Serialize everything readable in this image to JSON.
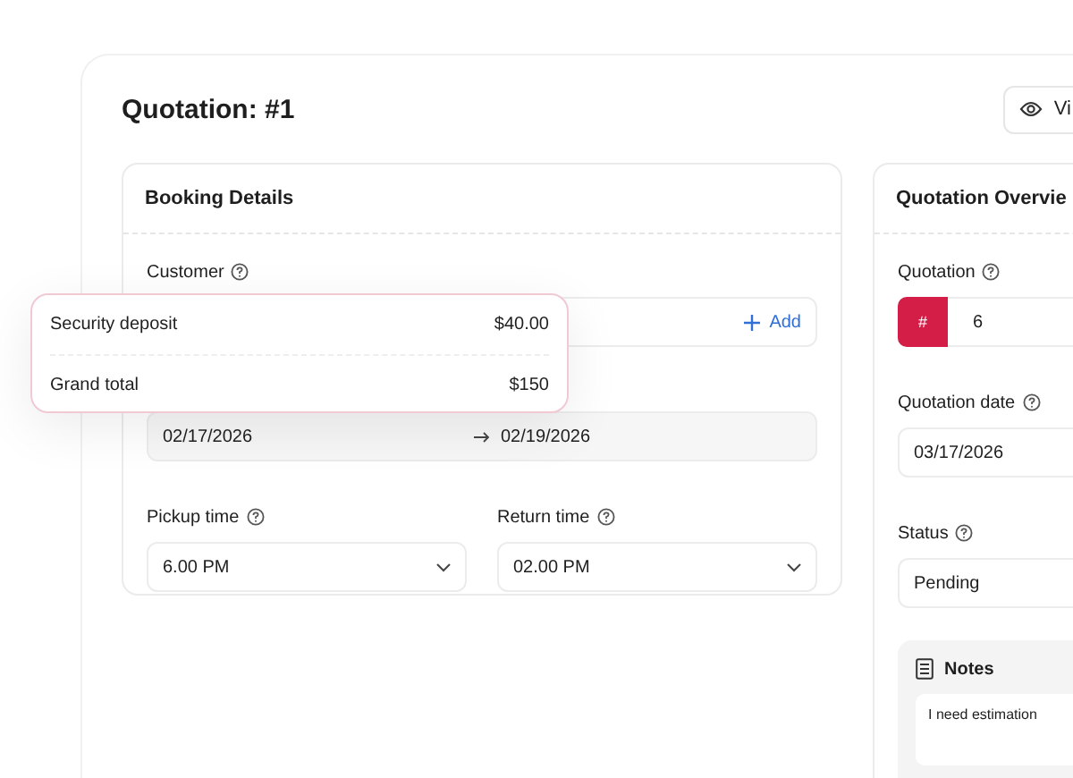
{
  "page": {
    "title": "Quotation: #1",
    "view_button": "Vi"
  },
  "booking": {
    "title": "Booking Details",
    "customer": {
      "label": "Customer",
      "add": "Add"
    },
    "period": {
      "start": "02/17/2026",
      "end": "02/19/2026"
    },
    "times": [
      {
        "label": "Pickup time",
        "value": "6.00 PM"
      },
      {
        "label": "Return time",
        "value": "02.00 PM"
      }
    ]
  },
  "overview": {
    "title": "Quotation Overvie",
    "fields": [
      {
        "kind": "prefixed",
        "label": "Quotation",
        "prefix": "#",
        "value": "6"
      },
      {
        "kind": "plain",
        "label": "Quotation date",
        "value": "03/17/2026"
      },
      {
        "kind": "plain",
        "label": "Status",
        "value": "Pending"
      }
    ],
    "notes": {
      "title": "Notes",
      "text": "I need estimation"
    }
  },
  "summary": [
    {
      "label": "Security deposit",
      "value": "$40.00"
    },
    {
      "label": "Grand total",
      "value": "$150"
    }
  ]
}
